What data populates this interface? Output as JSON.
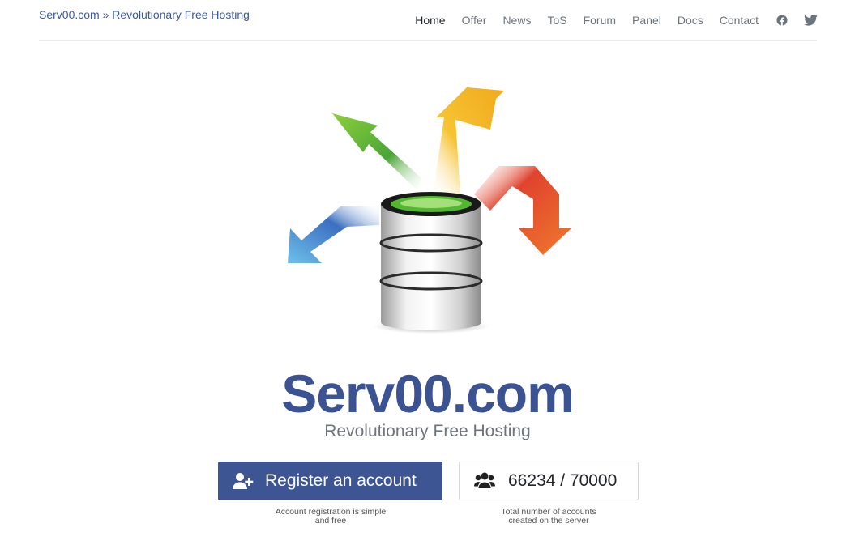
{
  "header": {
    "brand": "Serv00.com » Revolutionary Free Hosting",
    "nav": [
      {
        "label": "Home",
        "active": true
      },
      {
        "label": "Offer"
      },
      {
        "label": "News"
      },
      {
        "label": "ToS"
      },
      {
        "label": "Forum"
      },
      {
        "label": "Panel"
      },
      {
        "label": "Docs"
      },
      {
        "label": "Contact"
      }
    ],
    "social": [
      "facebook-icon",
      "twitter-icon"
    ]
  },
  "hero": {
    "title": "Serv00.com",
    "subtitle": "Revolutionary Free Hosting"
  },
  "actions": {
    "register_label": "Register an account",
    "register_caption_line1": "Account registration is simple",
    "register_caption_line2": "and free",
    "accounts_count": "66234 / 70000",
    "accounts_caption_line1": "Total number of accounts",
    "accounts_caption_line2": "created on the server"
  },
  "colors": {
    "brand": "#3d5593",
    "title": "#3b5392",
    "muted": "#6c757d"
  }
}
